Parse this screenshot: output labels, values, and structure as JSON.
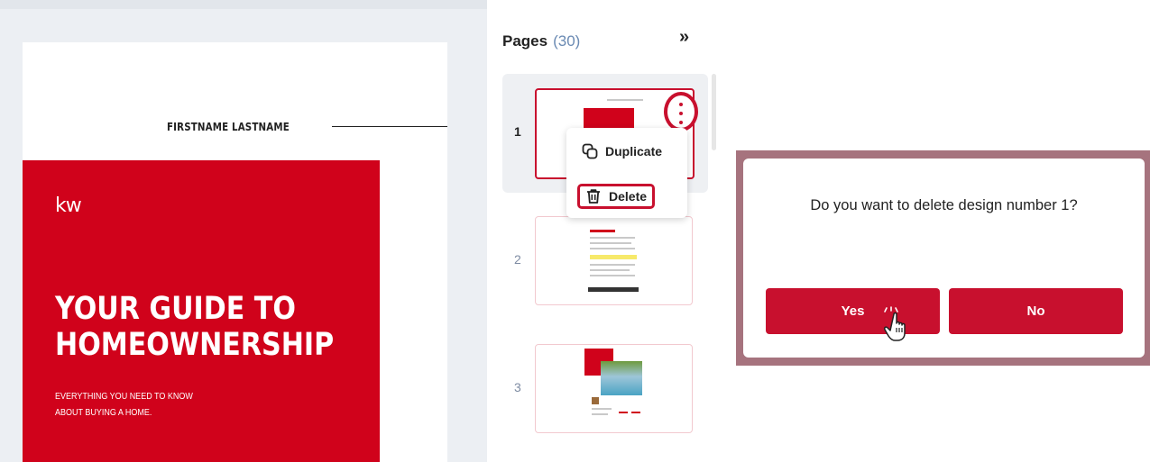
{
  "document_page": {
    "author_name": "FIRSTNAME LASTNAME",
    "logo_text": "kw",
    "cover_title_line1": "YOUR GUIDE TO",
    "cover_title_line2": "HOMEOWNERSHIP",
    "cover_subtitle_line1": "EVERYTHING YOU NEED TO KNOW",
    "cover_subtitle_line2": "ABOUT BUYING A HOME.",
    "cover_color": "#d0021b"
  },
  "pages_panel": {
    "title": "Pages",
    "count": "(30)",
    "collapse_icon": "chevron-double-right-icon",
    "pages": [
      {
        "number": "1",
        "selected": true
      },
      {
        "number": "2",
        "selected": false
      },
      {
        "number": "3",
        "selected": false
      }
    ]
  },
  "context_menu": {
    "items": [
      {
        "label": "Duplicate",
        "icon": "duplicate-icon"
      },
      {
        "label": "Delete",
        "icon": "trash-icon"
      }
    ]
  },
  "dialog": {
    "message": "Do you want to delete design number 1?",
    "yes_label": "Yes",
    "no_label": "No"
  },
  "colors": {
    "accent": "#c8102e",
    "page_count": "#6a8ab3"
  }
}
